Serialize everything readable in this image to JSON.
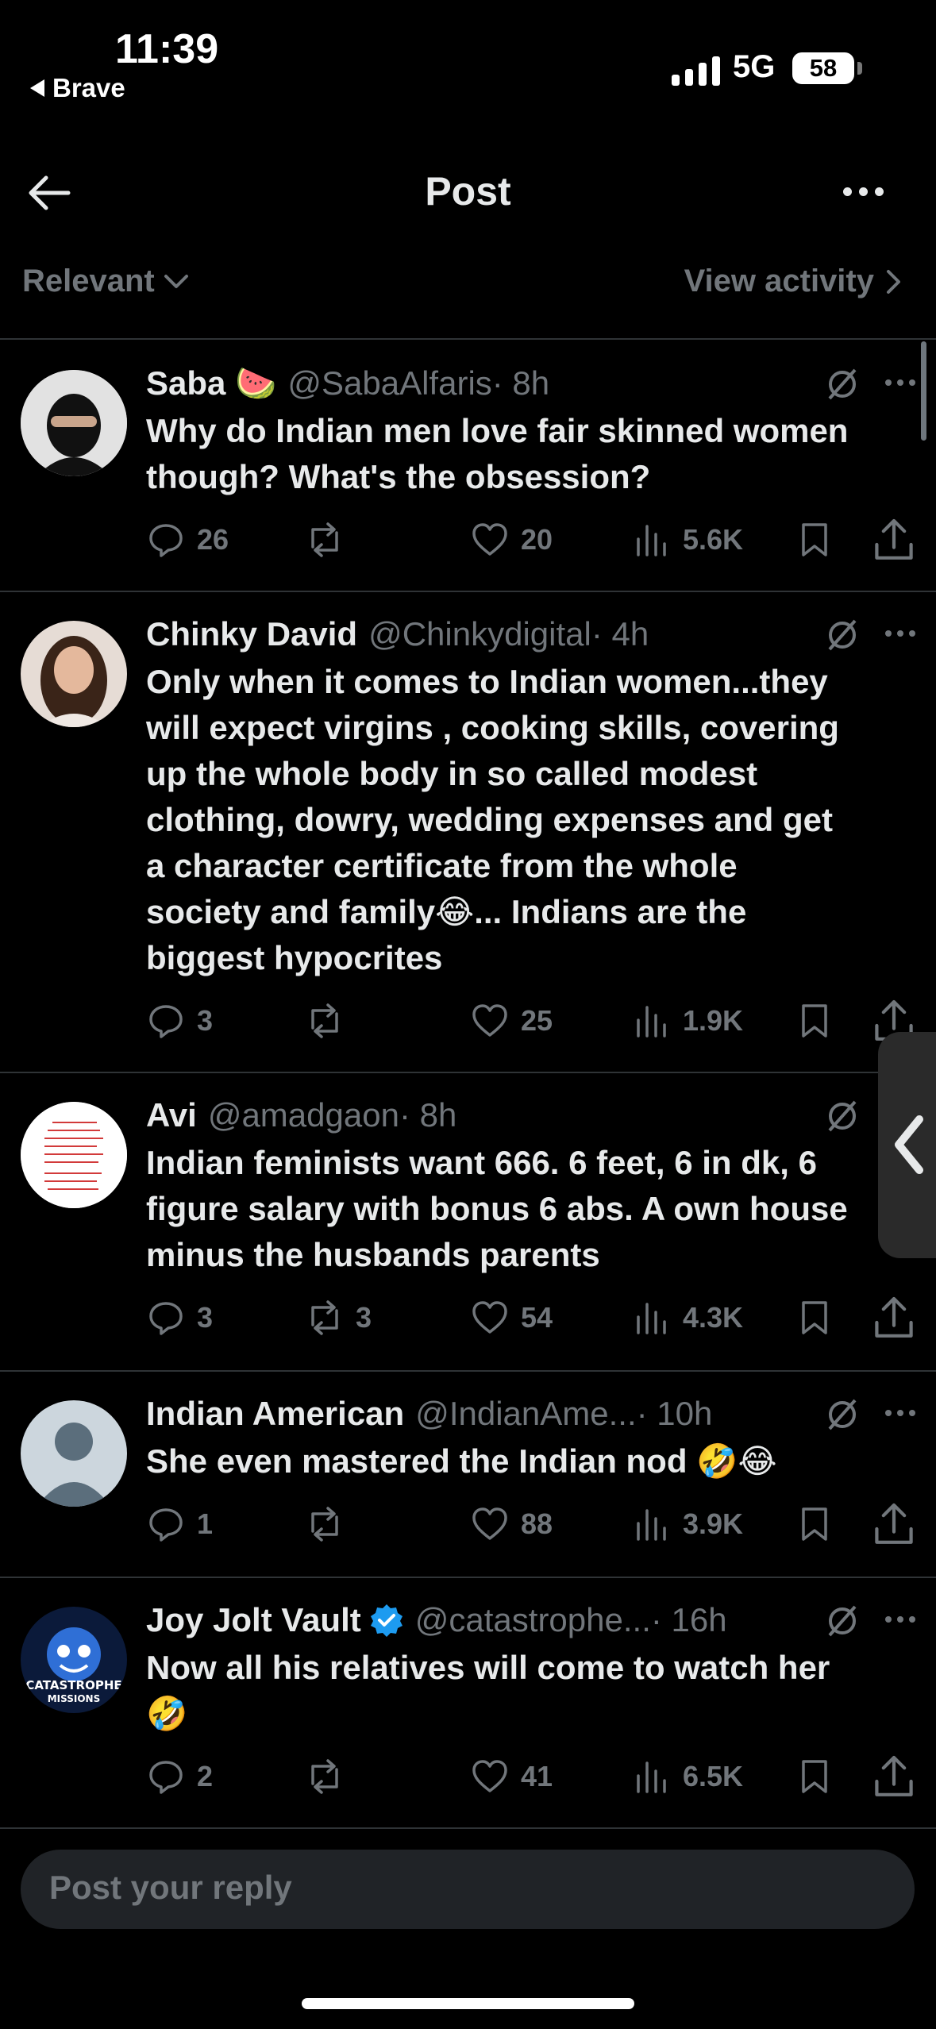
{
  "status_bar": {
    "time": "11:39",
    "back_app": "Brave",
    "network": "5G",
    "battery": "58"
  },
  "header": {
    "title": "Post"
  },
  "filter": {
    "sort_label": "Relevant",
    "activity_label": "View activity"
  },
  "replies": [
    {
      "name": "Saba 🍉",
      "handle": "@SabaAlfaris",
      "time": "· 8h",
      "text": [
        "Why do Indian men love fair skinned women",
        "though? What's the obsession?"
      ],
      "replies": "26",
      "reposts": "",
      "likes": "20",
      "views": "5.6K"
    },
    {
      "name": "Chinky David",
      "handle": "@Chinkydigital",
      "time": "· 4h",
      "text": [
        "Only when it comes to Indian women...they",
        "will expect virgins , cooking skills, covering",
        "up the whole body in so called modest",
        "clothing, dowry, wedding expenses and get",
        "a character certificate from the whole",
        "society and family😂... Indians are the",
        "biggest hypocrites"
      ],
      "replies": "3",
      "reposts": "",
      "likes": "25",
      "views": "1.9K"
    },
    {
      "name": "Avi",
      "handle": "@amadgaon",
      "time": "· 8h",
      "text": [
        "Indian feminists want 666. 6 feet, 6 in dk, 6",
        "figure salary with bonus 6 abs. A own house",
        "minus the husbands parents"
      ],
      "replies": "3",
      "reposts": "3",
      "likes": "54",
      "views": "4.3K"
    },
    {
      "name": "Indian American",
      "handle": "@IndianAme...",
      "time": "· 10h",
      "text": [
        "She even mastered the Indian nod 🤣😂"
      ],
      "replies": "1",
      "reposts": "",
      "likes": "88",
      "views": "3.9K"
    },
    {
      "name": "Joy Jolt Vault",
      "handle": "@catastrophe...",
      "time": "· 16h",
      "text": [
        "Now all his relatives will come to watch her",
        "🤣"
      ],
      "replies": "2",
      "reposts": "",
      "likes": "41",
      "views": "6.5K",
      "avatar_text": "CATASTROPHE MISSIONS"
    }
  ],
  "composer": {
    "placeholder": "Post your reply"
  },
  "colors": {
    "background": "#000000",
    "text": "#e7e9ea",
    "muted": "#71767b",
    "divider": "#2f3336",
    "verified": "#1d9bf0"
  }
}
